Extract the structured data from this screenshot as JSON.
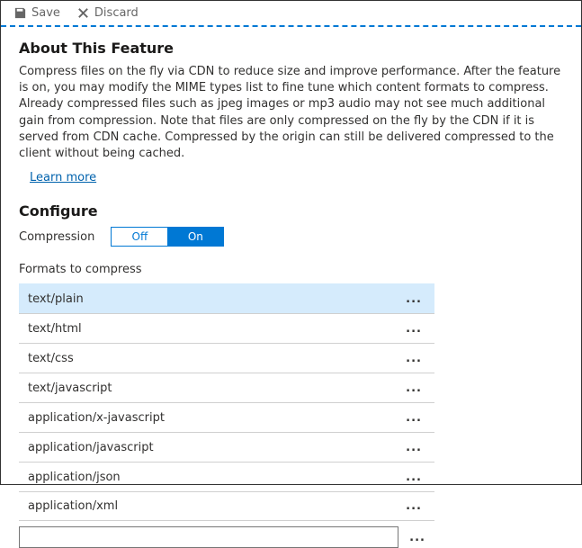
{
  "toolbar": {
    "save_label": "Save",
    "discard_label": "Discard"
  },
  "about": {
    "heading": "About This Feature",
    "description": "Compress files on the fly via CDN to reduce size and improve performance. After the feature is on, you may modify the MIME types list to fine tune which content formats to compress. Already compressed files such as jpeg images or mp3 audio may not see much additional gain from compression. Note that files are only compressed on the fly by the CDN if it is served from CDN cache. Compressed by the origin can still be delivered compressed to the client without being cached.",
    "learn_more": "Learn more"
  },
  "configure": {
    "heading": "Configure",
    "compression_label": "Compression",
    "toggle": {
      "off": "Off",
      "on": "On",
      "selected": "On"
    },
    "formats_label": "Formats to compress",
    "formats": [
      "text/plain",
      "text/html",
      "text/css",
      "text/javascript",
      "application/x-javascript",
      "application/javascript",
      "application/json",
      "application/xml"
    ],
    "ellipsis": "...",
    "add_input_value": ""
  }
}
